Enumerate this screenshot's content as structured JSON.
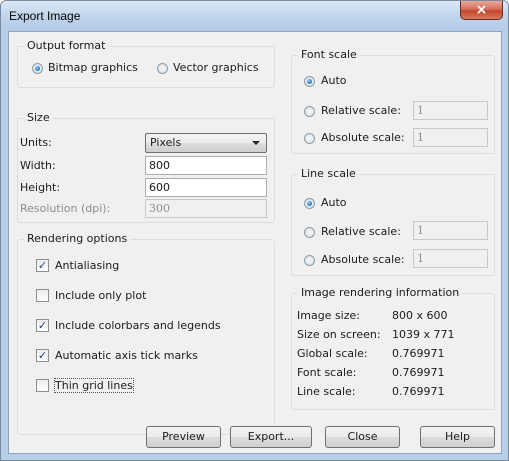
{
  "window": {
    "title": "Export Image",
    "close_icon": "×"
  },
  "output_format": {
    "title": "Output format",
    "bitmap_label": "Bitmap graphics",
    "vector_label": "Vector graphics",
    "selected": "bitmap"
  },
  "size": {
    "title": "Size",
    "units_label": "Units:",
    "units_value": "Pixels",
    "width_label": "Width:",
    "width_value": "800",
    "height_label": "Height:",
    "height_value": "600",
    "resolution_label": "Resolution (dpi):",
    "resolution_value": "300"
  },
  "rendering": {
    "title": "Rendering options",
    "options": [
      {
        "label": "Antialiasing",
        "checked": true
      },
      {
        "label": "Include only plot",
        "checked": false
      },
      {
        "label": "Include colorbars and legends",
        "checked": true
      },
      {
        "label": "Automatic axis tick marks",
        "checked": true
      },
      {
        "label": "Thin grid lines",
        "checked": false
      }
    ]
  },
  "font_scale": {
    "title": "Font scale",
    "auto_label": "Auto",
    "relative_label": "Relative scale:",
    "relative_value": "1",
    "absolute_label": "Absolute scale:",
    "absolute_value": "1",
    "selected": "auto"
  },
  "line_scale": {
    "title": "Line scale",
    "auto_label": "Auto",
    "relative_label": "Relative scale:",
    "relative_value": "1",
    "absolute_label": "Absolute scale:",
    "absolute_value": "1",
    "selected": "auto"
  },
  "info": {
    "title": "Image rendering information",
    "rows": [
      {
        "label": "Image size:",
        "value": "800 x 600"
      },
      {
        "label": "Size on screen:",
        "value": "1039 x 771"
      },
      {
        "label": "Global scale:",
        "value": "0.769971"
      },
      {
        "label": "Font scale:",
        "value": "0.769971"
      },
      {
        "label": "Line scale:",
        "value": "0.769971"
      }
    ]
  },
  "buttons": {
    "preview": "Preview",
    "export": "Export...",
    "close": "Close",
    "help": "Help"
  },
  "check_glyph": "✓"
}
